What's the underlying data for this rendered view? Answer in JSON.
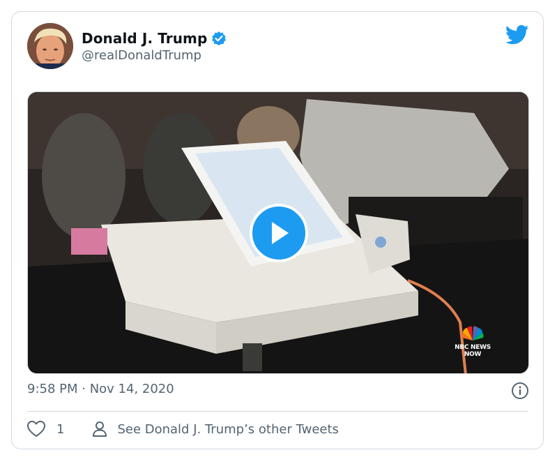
{
  "tweet": {
    "author_name": "Donald J. Trump",
    "author_handle": "@realDonaldTrump",
    "timestamp": "9:58 PM · Nov 14, 2020",
    "like_count": "1",
    "other_tweets_label": "See Donald J. Trump’s other Tweets"
  },
  "media": {
    "watermark_line1": "NBC NEWS",
    "watermark_line2": "NOW"
  },
  "colors": {
    "accent": "#1d9bf0",
    "secondary_text": "#536471",
    "border": "#cfd9de"
  },
  "icons": [
    "verified-badge-icon",
    "twitter-bird-icon",
    "play-icon",
    "info-icon",
    "heart-icon",
    "person-icon"
  ]
}
